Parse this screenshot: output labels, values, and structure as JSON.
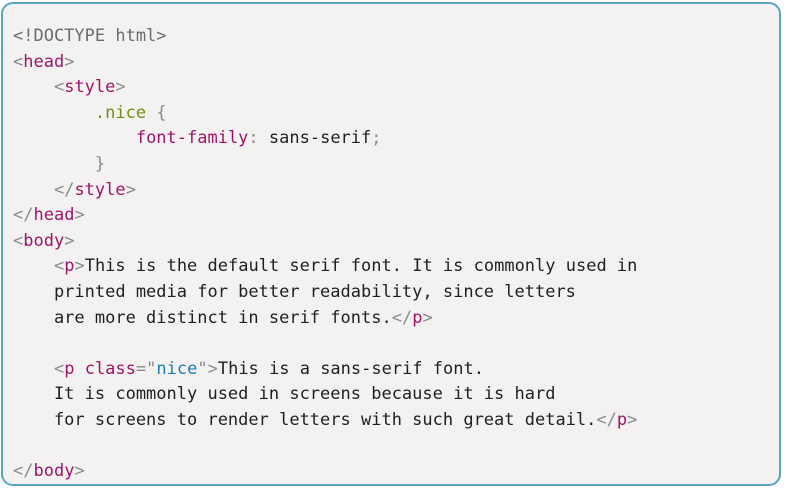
{
  "colors": {
    "panel_background": "#f3f2f1",
    "panel_border": "#5aa3c9",
    "punctuation": "#8a8a8a",
    "doctype": "#6b6b6b",
    "tag": "#a0136a",
    "property": "#a0136a",
    "attribute": "#a0136a",
    "selector": "#6f8f12",
    "string": "#1c7fb0",
    "text": "#1f1f1f"
  },
  "code_lines": [
    [
      {
        "t": "<!DOCTYPE html>",
        "k": "doctype"
      }
    ],
    [
      {
        "t": "<",
        "k": "punctuation"
      },
      {
        "t": "head",
        "k": "tag"
      },
      {
        "t": ">",
        "k": "punctuation"
      }
    ],
    [
      {
        "t": "    ",
        "k": "text"
      },
      {
        "t": "<",
        "k": "punctuation"
      },
      {
        "t": "style",
        "k": "tag"
      },
      {
        "t": ">",
        "k": "punctuation"
      }
    ],
    [
      {
        "t": "        ",
        "k": "text"
      },
      {
        "t": ".nice",
        "k": "selector"
      },
      {
        "t": " {",
        "k": "punctuation"
      }
    ],
    [
      {
        "t": "            ",
        "k": "text"
      },
      {
        "t": "font-family",
        "k": "property"
      },
      {
        "t": ": ",
        "k": "punctuation"
      },
      {
        "t": "sans-serif",
        "k": "text"
      },
      {
        "t": ";",
        "k": "punctuation"
      }
    ],
    [
      {
        "t": "        ",
        "k": "text"
      },
      {
        "t": "}",
        "k": "punctuation"
      }
    ],
    [
      {
        "t": "    ",
        "k": "text"
      },
      {
        "t": "</",
        "k": "punctuation"
      },
      {
        "t": "style",
        "k": "tag"
      },
      {
        "t": ">",
        "k": "punctuation"
      }
    ],
    [
      {
        "t": "</",
        "k": "punctuation"
      },
      {
        "t": "head",
        "k": "tag"
      },
      {
        "t": ">",
        "k": "punctuation"
      }
    ],
    [
      {
        "t": "<",
        "k": "punctuation"
      },
      {
        "t": "body",
        "k": "tag"
      },
      {
        "t": ">",
        "k": "punctuation"
      }
    ],
    [
      {
        "t": "    ",
        "k": "text"
      },
      {
        "t": "<",
        "k": "punctuation"
      },
      {
        "t": "p",
        "k": "tag"
      },
      {
        "t": ">",
        "k": "punctuation"
      },
      {
        "t": "This is the default serif font. It is commonly used in",
        "k": "text"
      }
    ],
    [
      {
        "t": "    printed media for better readability, since letters",
        "k": "text"
      }
    ],
    [
      {
        "t": "    are more distinct in serif fonts.",
        "k": "text"
      },
      {
        "t": "</",
        "k": "punctuation"
      },
      {
        "t": "p",
        "k": "tag"
      },
      {
        "t": ">",
        "k": "punctuation"
      }
    ],
    [],
    [
      {
        "t": "    ",
        "k": "text"
      },
      {
        "t": "<",
        "k": "punctuation"
      },
      {
        "t": "p",
        "k": "tag"
      },
      {
        "t": " ",
        "k": "text"
      },
      {
        "t": "class",
        "k": "attribute"
      },
      {
        "t": "=",
        "k": "punctuation"
      },
      {
        "t": "\"",
        "k": "punctuation"
      },
      {
        "t": "nice",
        "k": "string"
      },
      {
        "t": "\"",
        "k": "punctuation"
      },
      {
        "t": ">",
        "k": "punctuation"
      },
      {
        "t": "This is a sans-serif font.",
        "k": "text"
      }
    ],
    [
      {
        "t": "    It is commonly used in screens because it is hard",
        "k": "text"
      }
    ],
    [
      {
        "t": "    for screens to render letters with such great detail.",
        "k": "text"
      },
      {
        "t": "</",
        "k": "punctuation"
      },
      {
        "t": "p",
        "k": "tag"
      },
      {
        "t": ">",
        "k": "punctuation"
      }
    ],
    [],
    [
      {
        "t": "</",
        "k": "punctuation"
      },
      {
        "t": "body",
        "k": "tag"
      },
      {
        "t": ">",
        "k": "punctuation"
      }
    ]
  ]
}
